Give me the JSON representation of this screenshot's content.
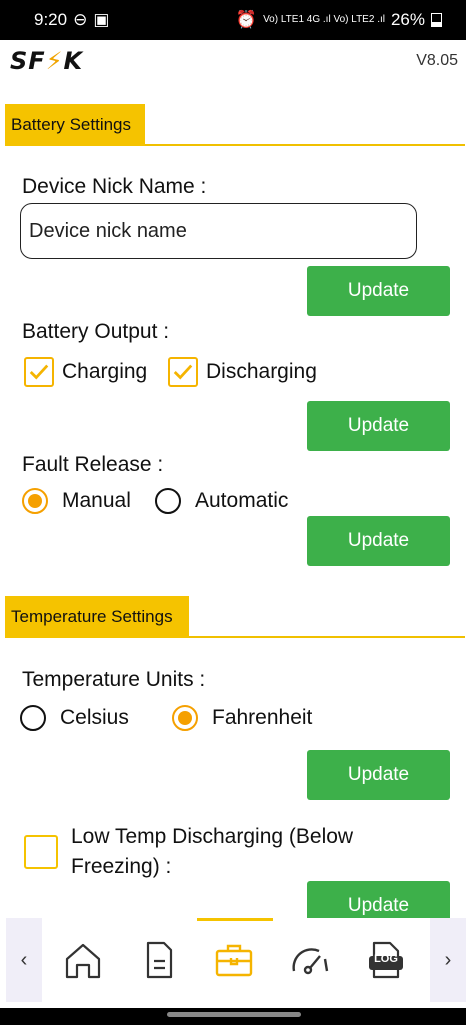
{
  "status_bar": {
    "time": "9:20",
    "network": "Vo) LTE1 4G .ıl Vo) LTE2 .ıl",
    "battery": "26%"
  },
  "header": {
    "logo": "SFK",
    "version": "V8.05"
  },
  "battery_settings": {
    "section_title": "Battery Settings",
    "nickname_label": "Device Nick Name :",
    "nickname_value": "Device nick name",
    "update_label": "Update",
    "output_label": "Battery Output :",
    "charging_label": "Charging",
    "charging_checked": true,
    "discharging_label": "Discharging",
    "discharging_checked": true,
    "fault_label": "Fault Release :",
    "manual_label": "Manual",
    "automatic_label": "Automatic",
    "fault_selected": "Manual"
  },
  "temperature_settings": {
    "section_title": "Temperature Settings",
    "units_label": "Temperature Units :",
    "celsius_label": "Celsius",
    "fahrenheit_label": "Fahrenheit",
    "units_selected": "Fahrenheit",
    "low_temp_label": "Low Temp Discharging (Below Freezing) :",
    "low_temp_checked": false,
    "update_label": "Update"
  },
  "bottom_nav": {
    "items": [
      "home-icon",
      "document-icon",
      "toolbox-icon",
      "gauge-icon",
      "log-icon"
    ],
    "active": "toolbox-icon",
    "log_text": "LOG"
  },
  "colors": {
    "accent_yellow": "#f5c300",
    "button_green": "#3db04a",
    "radio_orange": "#f5a000"
  }
}
